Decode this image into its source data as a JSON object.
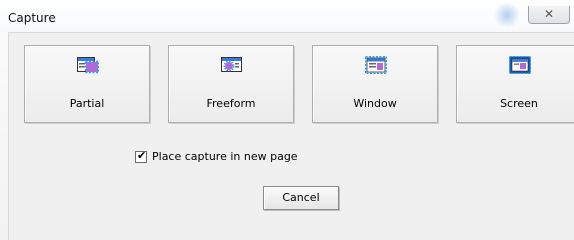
{
  "window": {
    "title": "Capture",
    "close_glyph": "✕"
  },
  "capture_modes": [
    {
      "label": "Partial",
      "icon": "partial-capture-icon"
    },
    {
      "label": "Freeform",
      "icon": "freeform-capture-icon"
    },
    {
      "label": "Window",
      "icon": "window-capture-icon"
    },
    {
      "label": "Screen",
      "icon": "screen-capture-icon"
    }
  ],
  "options": {
    "place_in_new_page_label": "Place capture in new page",
    "place_in_new_page_checked": true,
    "check_glyph": "✔"
  },
  "actions": {
    "cancel_label": "Cancel"
  },
  "colors": {
    "selection_dash": "#1aa0ff",
    "icon_purple": "#b06ad6",
    "icon_blue": "#3a7bd5"
  }
}
